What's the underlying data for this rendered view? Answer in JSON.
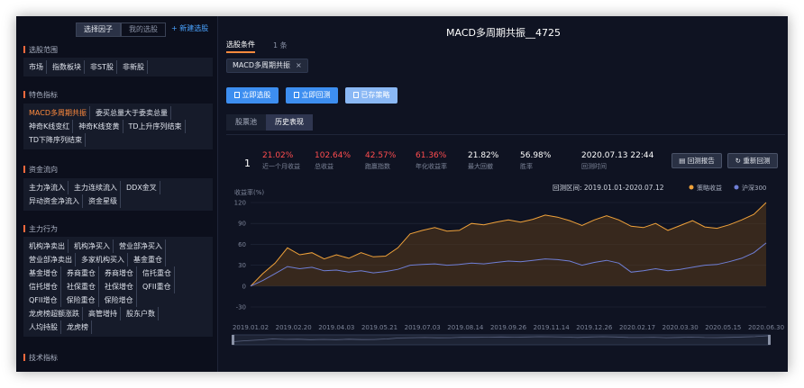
{
  "sidebar": {
    "tabs": [
      "选择因子",
      "我的选股"
    ],
    "new_button": "+ 新建选股",
    "groups": [
      {
        "title": "选股范围",
        "items": [
          "市场",
          "指数板块",
          "非ST股",
          "非新股"
        ]
      },
      {
        "title": "特色指标",
        "items": [
          "MACD多周期共振",
          "委买总量大于委卖总量",
          "神奇K线变红",
          "神奇K线变黄",
          "TD上升序列结束",
          "TD下降序列结束"
        ]
      },
      {
        "title": "资金流向",
        "items": [
          "主力净流入",
          "主力连续流入",
          "DDX金叉",
          "异动资金净流入",
          "资金星级"
        ]
      },
      {
        "title": "主力行为",
        "items": [
          "机构净卖出",
          "机构净买入",
          "营业部净买入",
          "营业部净卖出",
          "多家机构买入",
          "基金重仓",
          "基金增仓",
          "券商重仓",
          "券商增仓",
          "信托重仓",
          "信托增仓",
          "社保重仓",
          "社保增仓",
          "QFII重仓",
          "QFII增仓",
          "保险重仓",
          "保险增仓",
          "龙虎榜超额涨跌",
          "高管增持",
          "股东户数",
          "人均持股",
          "龙虎榜"
        ]
      },
      {
        "title": "技术指标",
        "items": []
      }
    ]
  },
  "main": {
    "title": "MACD多周期共振__4725",
    "cond_tab": "选股条件",
    "cond_count": "1 条",
    "chip": "MACD多周期共振",
    "chip_close": "×",
    "buttons": [
      "立即选股",
      "立即回测",
      "已存策略"
    ],
    "subtabs": [
      "股票池",
      "历史表现"
    ],
    "rank": "1",
    "metrics": [
      {
        "value": "21.02%",
        "label": "近一个月收益",
        "color": "red"
      },
      {
        "value": "102.64%",
        "label": "总收益",
        "color": "red"
      },
      {
        "value": "42.57%",
        "label": "跑赢指数",
        "color": "red"
      },
      {
        "value": "61.36%",
        "label": "年化收益率",
        "color": "red"
      },
      {
        "value": "21.82%",
        "label": "最大回撤",
        "color": "white"
      },
      {
        "value": "56.98%",
        "label": "胜率",
        "color": "white"
      },
      {
        "value": "2020.07.13 22:44",
        "label": "回测时间",
        "color": "white"
      }
    ],
    "report_button": "回测报告",
    "rerun_button": "重新回测"
  },
  "chart_data": {
    "type": "area",
    "ylabel": "收益率(%)",
    "period_label": "回测区间: 2019.01.01-2020.07.12",
    "legend": [
      "策略收益",
      "沪深300"
    ],
    "legend_placement": "top-right",
    "ylim": [
      -30,
      120
    ],
    "yticks": [
      120,
      90,
      60,
      30,
      0,
      -30
    ],
    "x_labels": [
      "2019.01.02",
      "2019.02.20",
      "2019.04.03",
      "2019.05.21",
      "2019.07.03",
      "2019.08.14",
      "2019.09.26",
      "2019.11.14",
      "2019.12.26",
      "2020.02.17",
      "2020.03.30",
      "2020.05.15",
      "2020.06.30"
    ],
    "series": [
      {
        "name": "策略收益",
        "color": "#f0a23a",
        "values": [
          0,
          18,
          33,
          55,
          45,
          48,
          39,
          45,
          40,
          48,
          42,
          43,
          55,
          75,
          80,
          84,
          79,
          80,
          90,
          88,
          92,
          95,
          92,
          96,
          102,
          99,
          94,
          87,
          95,
          101,
          95,
          86,
          84,
          90,
          80,
          87,
          94,
          85,
          83,
          88,
          95,
          103,
          120
        ]
      },
      {
        "name": "沪深300",
        "color": "#6f7fd6",
        "values": [
          0,
          8,
          18,
          28,
          25,
          27,
          22,
          23,
          20,
          22,
          19,
          21,
          24,
          30,
          31,
          32,
          30,
          31,
          33,
          32,
          34,
          36,
          35,
          37,
          39,
          38,
          36,
          30,
          34,
          37,
          33,
          20,
          22,
          25,
          22,
          24,
          27,
          30,
          31,
          35,
          40,
          48,
          62
        ]
      }
    ],
    "colors": {
      "strategy": "#f0a23a",
      "index": "#6f7fd6",
      "fill": "#5a3a1a"
    }
  }
}
